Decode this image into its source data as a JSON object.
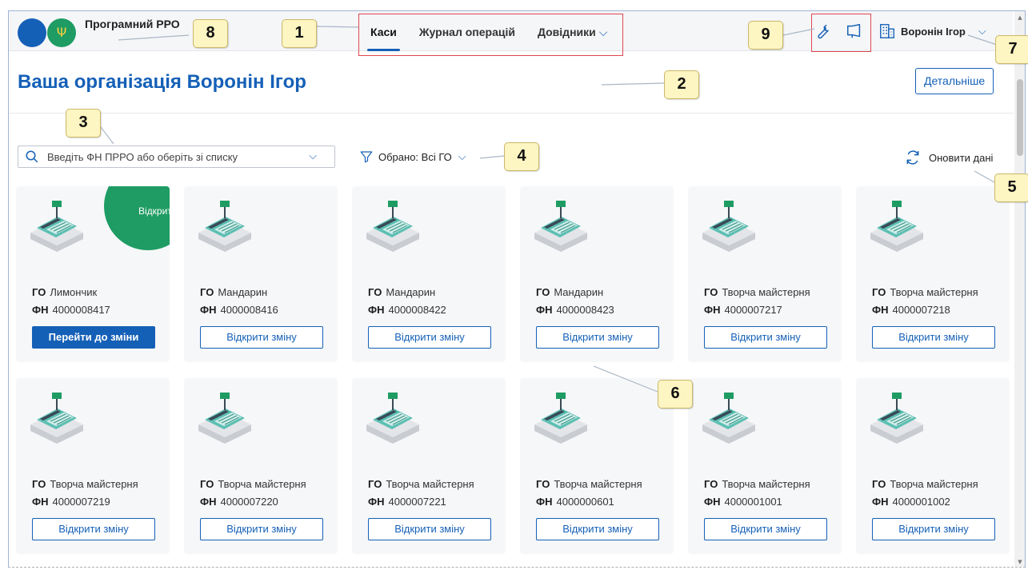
{
  "header": {
    "logo_text": "Програмний РРО",
    "tabs": [
      {
        "label": "Каси",
        "active": true
      },
      {
        "label": "Журнал операцій",
        "active": false
      },
      {
        "label": "Довідники",
        "active": false,
        "has_dropdown": true
      }
    ],
    "tool_icons": [
      "wrench-icon",
      "megaphone-icon"
    ],
    "user_name": "Воронін Ігор"
  },
  "title_section": {
    "title": "Ваша організація Воронін Ігор",
    "details_label": "Детальніше"
  },
  "filters": {
    "search_placeholder": "Введіть ФН ПРРО або оберіть зі списку",
    "selected_filter": "Обрано: Всі ГО",
    "refresh_label": "Оновити дані"
  },
  "labels": {
    "go": "ГО",
    "fn": "ФН"
  },
  "cards": [
    {
      "go": "Лимончик",
      "fn": "4000008417",
      "action": "Перейти до зміни",
      "primary": true,
      "badge": "Відкрита"
    },
    {
      "go": "Мандарин",
      "fn": "4000008416",
      "action": "Відкрити зміну"
    },
    {
      "go": "Мандарин",
      "fn": "4000008422",
      "action": "Відкрити зміну"
    },
    {
      "go": "Мандарин",
      "fn": "4000008423",
      "action": "Відкрити зміну"
    },
    {
      "go": "Творча майстерня",
      "fn": "4000007217",
      "action": "Відкрити зміну"
    },
    {
      "go": "Творча майстерня",
      "fn": "4000007218",
      "action": "Відкрити зміну"
    },
    {
      "go": "Творча майстерня",
      "fn": "4000007219",
      "action": "Відкрити зміну"
    },
    {
      "go": "Творча майстерня",
      "fn": "4000007220",
      "action": "Відкрити зміну"
    },
    {
      "go": "Творча майстерня",
      "fn": "4000007221",
      "action": "Відкрити зміну"
    },
    {
      "go": "Творча майстерня",
      "fn": "4000000601",
      "action": "Відкрити зміну"
    },
    {
      "go": "Творча майстерня",
      "fn": "4000001001",
      "action": "Відкрити зміну"
    },
    {
      "go": "Творча майстерня",
      "fn": "4000001002",
      "action": "Відкрити зміну"
    }
  ],
  "callouts": [
    "1",
    "2",
    "3",
    "4",
    "5",
    "6",
    "7",
    "8",
    "9"
  ],
  "colors": {
    "accent": "#1560b7",
    "open_badge": "#1e9c63",
    "callout_bg": "#fdf5c2",
    "highlight_box": "#e0474f"
  }
}
